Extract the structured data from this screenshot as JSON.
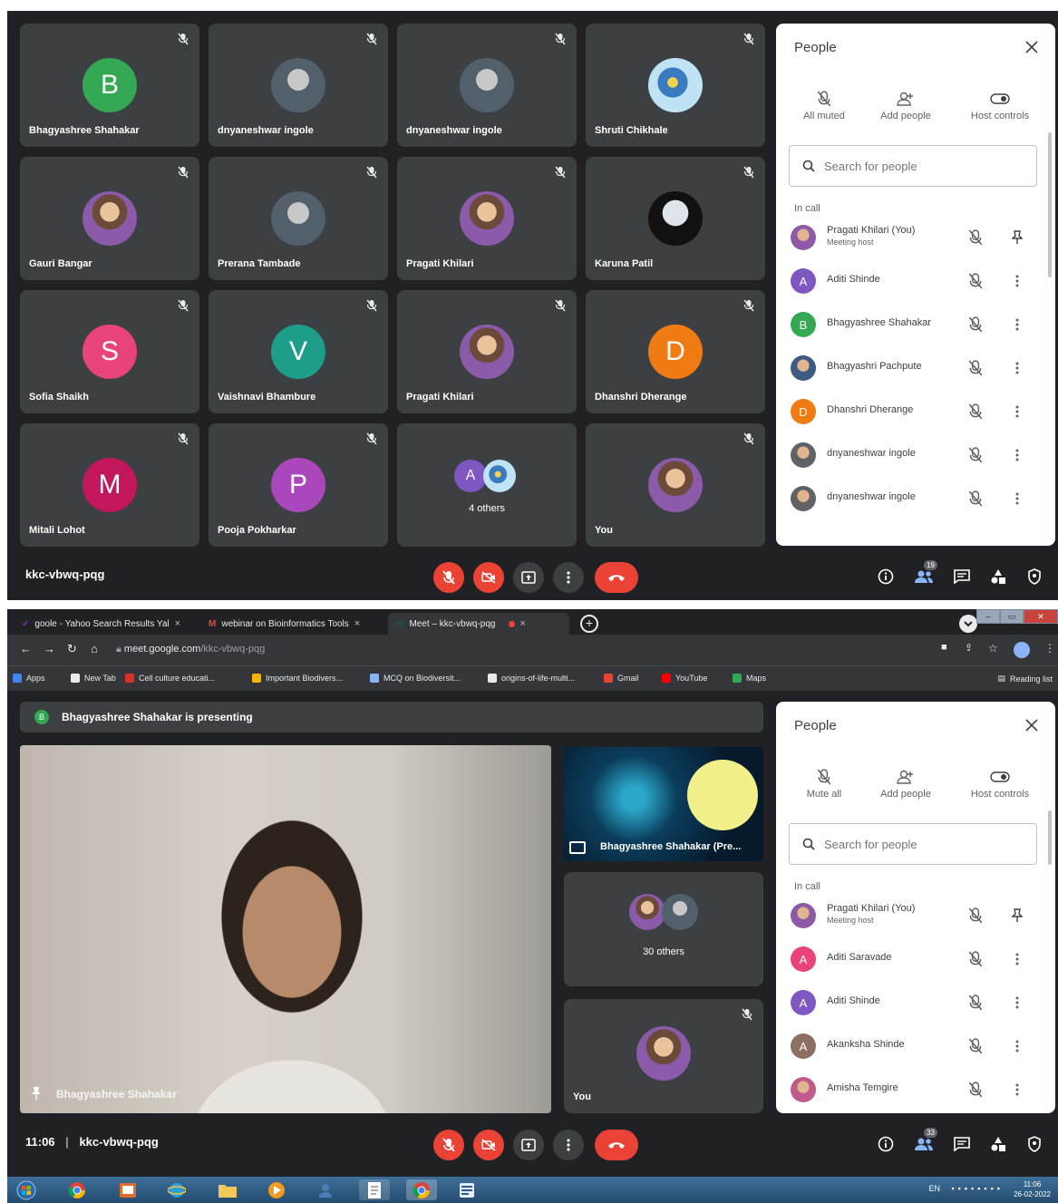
{
  "meeting": {
    "code": "kkc-vbwq-pqg",
    "time": "11:06",
    "separator": "|"
  },
  "grid": [
    {
      "name": "Bhagyashree Shahakar",
      "initial": "B",
      "color": "#34a853"
    },
    {
      "name": "dnyaneshwar ingole",
      "initial": "",
      "color": ""
    },
    {
      "name": "dnyaneshwar ingole",
      "initial": "",
      "color": ""
    },
    {
      "name": "Shruti Chikhale",
      "initial": "",
      "color": ""
    },
    {
      "name": "Gauri Bangar",
      "initial": "",
      "color": ""
    },
    {
      "name": "Prerana Tambade",
      "initial": "",
      "color": ""
    },
    {
      "name": "Pragati Khilari",
      "initial": "",
      "color": ""
    },
    {
      "name": "Karuna Patil",
      "initial": "",
      "color": ""
    },
    {
      "name": "Sofia Shaikh",
      "initial": "S",
      "color": "#e8437a"
    },
    {
      "name": "Vaishnavi Bhambure",
      "initial": "V",
      "color": "#1e9e8a"
    },
    {
      "name": "Pragati Khilari",
      "initial": "",
      "color": ""
    },
    {
      "name": "Dhanshri Dherange",
      "initial": "D",
      "color": "#f07b12"
    },
    {
      "name": "Mitali Lohot",
      "initial": "M",
      "color": "#c2185b"
    },
    {
      "name": "Pooja Pokharkar",
      "initial": "P",
      "color": "#ab47bc"
    },
    {
      "name": "4 others",
      "initial": "A",
      "color": "#7e57c2"
    },
    {
      "name": "You",
      "initial": "",
      "color": ""
    }
  ],
  "panel1": {
    "title": "People",
    "actions": [
      "All muted",
      "Add people",
      "Host controls"
    ],
    "search_placeholder": "Search for people",
    "section": "In call",
    "participants": [
      {
        "name": "Pragati Khilari (You)",
        "sub": "Meeting host",
        "initial": "",
        "color": "#8e5aa8",
        "action": "pin"
      },
      {
        "name": "Aditi Shinde",
        "sub": "",
        "initial": "A",
        "color": "#7e57c2",
        "action": "more"
      },
      {
        "name": "Bhagyashree Shahakar",
        "sub": "",
        "initial": "B",
        "color": "#34a853",
        "action": "more"
      },
      {
        "name": "Bhagyashri Pachpute",
        "sub": "",
        "initial": "",
        "color": "#3d5a80",
        "action": "more"
      },
      {
        "name": "Dhanshri Dherange",
        "sub": "",
        "initial": "D",
        "color": "#f07b12",
        "action": "more"
      },
      {
        "name": "dnyaneshwar ingole",
        "sub": "",
        "initial": "",
        "color": "#5f6368",
        "action": "more"
      },
      {
        "name": "dnyaneshwar ingole",
        "sub": "",
        "initial": "",
        "color": "#5f6368",
        "action": "more"
      }
    ]
  },
  "controls": {
    "people_count_1": "19",
    "people_count_2": "33"
  },
  "browser": {
    "tabs": [
      {
        "label": "goole - Yahoo Search Results Yal",
        "close": "×"
      },
      {
        "label": "webinar on Bioinformatics Tools",
        "close": "×"
      },
      {
        "label": "Meet – kkc-vbwq-pqg",
        "close": "×"
      }
    ],
    "url_host": "meet.google.com",
    "url_path": "/kkc-vbwq-pqg",
    "bookmarks": [
      {
        "label": "Apps",
        "color": "#4285f4"
      },
      {
        "label": "New Tab",
        "color": "#e8eaed"
      },
      {
        "label": "Cell culture educati...",
        "color": "#d93025"
      },
      {
        "label": "Important Biodivers...",
        "color": "#f4b400"
      },
      {
        "label": "MCQ on Biodiversit...",
        "color": "#8ab4f8"
      },
      {
        "label": "origins-of-life-multi...",
        "color": "#e8eaed"
      },
      {
        "label": "Gmail",
        "color": "#ea4335"
      },
      {
        "label": "YouTube",
        "color": "#ff0000"
      },
      {
        "label": "Maps",
        "color": "#34a853"
      }
    ],
    "reading_list": "Reading list"
  },
  "presentation": {
    "banner": "Bhagyashree Shahakar is presenting",
    "banner_initial": "B",
    "main_name": "Bhagyashree Shahakar",
    "slide_name": "Bhagyashree Shahakar (Pre...",
    "others": "30 others",
    "you": "You"
  },
  "panel2": {
    "title": "People",
    "actions": [
      "Mute all",
      "Add people",
      "Host controls"
    ],
    "search_placeholder": "Search for people",
    "section": "In call",
    "participants": [
      {
        "name": "Pragati Khilari (You)",
        "sub": "Meeting host",
        "initial": "",
        "color": "#8e5aa8",
        "action": "pin"
      },
      {
        "name": "Aditi Saravade",
        "sub": "",
        "initial": "A",
        "color": "#e8437a",
        "action": "more"
      },
      {
        "name": "Aditi Shinde",
        "sub": "",
        "initial": "A",
        "color": "#7e57c2",
        "action": "more"
      },
      {
        "name": "Akanksha Shinde",
        "sub": "",
        "initial": "A",
        "color": "#8d6e63",
        "action": "more"
      },
      {
        "name": "Amisha Temgire",
        "sub": "",
        "initial": "",
        "color": "#c05a8a",
        "action": "more"
      }
    ]
  },
  "taskbar": {
    "clock_time": "11:06",
    "clock_date": "26-02-2022",
    "lang": "EN"
  }
}
